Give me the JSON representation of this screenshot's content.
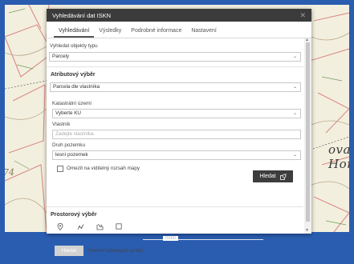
{
  "map": {
    "label_main": "ova Hora",
    "label_side": "74"
  },
  "dialog": {
    "title": "Vyhledávání dat ISKN",
    "close_glyph": "✕",
    "tabs": [
      {
        "label": "Vyhledávání"
      },
      {
        "label": "Výsledky"
      },
      {
        "label": "Podrobné informace"
      },
      {
        "label": "Nastavení"
      }
    ],
    "object_type": {
      "label": "Vyhledat objekty typu",
      "value": "Parcely"
    },
    "attr_section": {
      "title": "Atributový výběr",
      "mode_value": "Parcela dle vlastníka",
      "ku": {
        "label": "Katastrální území",
        "value": "Vyberte KU"
      },
      "owner": {
        "label": "Vlastník",
        "placeholder": "Zadejte vlastníka"
      },
      "land_type": {
        "label": "Druh pozemku",
        "value": "lesní pozemek"
      },
      "limit_checkbox": "Omezit na viditelný rozsah mapy",
      "search_button": "Hledat"
    },
    "spatial_section": {
      "title": "Prostorový výběr",
      "tools": [
        "point-tool-icon",
        "polyline-tool-icon",
        "polygon-tool-icon",
        "rectangle-tool-icon"
      ],
      "separator": "nebo",
      "search_button": "Hledat",
      "selected_features": "Pomocí vybraných prvků"
    }
  }
}
